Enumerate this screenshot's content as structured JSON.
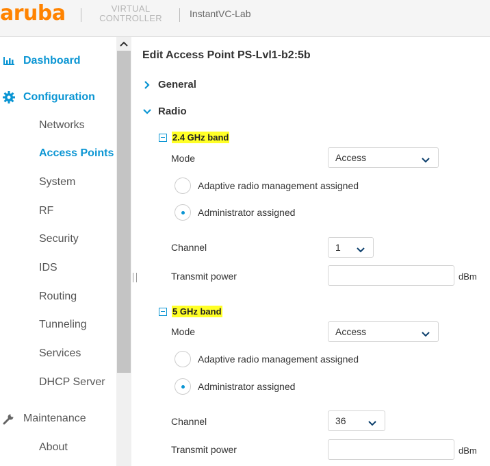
{
  "header": {
    "logo": "aruba",
    "product_line1": "VIRTUAL",
    "product_line2": "CONTROLLER",
    "site_name": "InstantVC-Lab"
  },
  "sidebar": {
    "dashboard": {
      "label": "Dashboard",
      "icon": "bar-chart-icon"
    },
    "configuration": {
      "label": "Configuration",
      "icon": "gear-icon"
    },
    "items": [
      {
        "label": "Networks"
      },
      {
        "label": "Access Points",
        "active": true
      },
      {
        "label": "System"
      },
      {
        "label": "RF"
      },
      {
        "label": "Security"
      },
      {
        "label": "IDS"
      },
      {
        "label": "Routing"
      },
      {
        "label": "Tunneling"
      },
      {
        "label": "Services"
      },
      {
        "label": "DHCP Server"
      }
    ],
    "maintenance": {
      "label": "Maintenance",
      "icon": "wrench-icon"
    },
    "about": {
      "label": "About"
    }
  },
  "main": {
    "title": "Edit Access Point PS-Lvl1-b2:5b",
    "general_section": "General",
    "radio_section": "Radio",
    "band24": {
      "label": "2.4 GHz band",
      "mode_label": "Mode",
      "mode_value": "Access",
      "radio_adaptive": "Adaptive radio management assigned",
      "radio_admin": "Administrator assigned",
      "selected": "admin",
      "channel_label": "Channel",
      "channel_value": "1",
      "tx_label": "Transmit power",
      "tx_value": "",
      "tx_unit": "dBm"
    },
    "band5": {
      "label": "5 GHz band",
      "mode_label": "Mode",
      "mode_value": "Access",
      "radio_adaptive": "Adaptive radio management assigned",
      "radio_admin": "Administrator assigned",
      "selected": "admin",
      "channel_label": "Channel",
      "channel_value": "36",
      "tx_label": "Transmit power",
      "tx_value": "",
      "tx_unit": "dBm"
    }
  },
  "colors": {
    "brand": "#ff8300",
    "accent": "#0a95d3",
    "highlight": "#ffff26"
  }
}
